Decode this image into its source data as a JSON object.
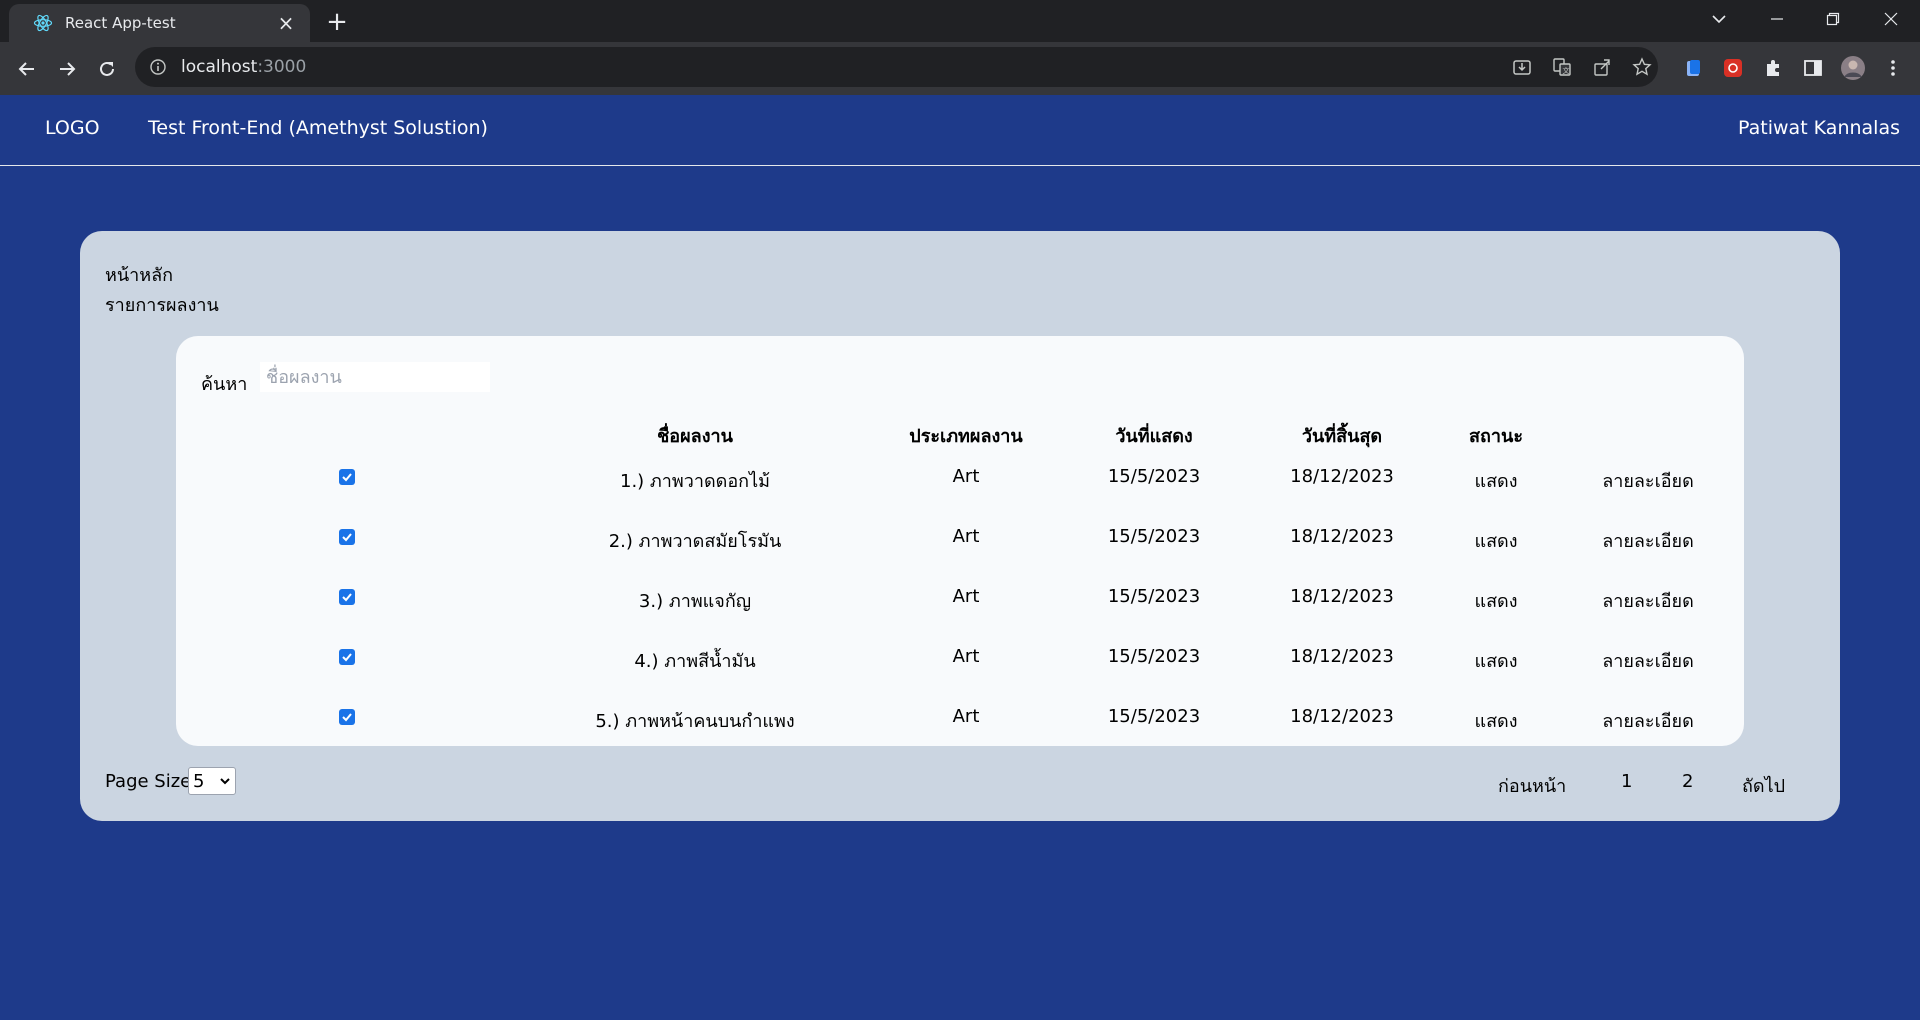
{
  "browser": {
    "tab_title": "React App-test",
    "url_host": "localhost",
    "url_port": ":3000"
  },
  "nav": {
    "logo": "LOGO",
    "title": "Test Front-End (Amethyst Solustion)",
    "user": "Patiwat Kannalas"
  },
  "breadcrumb": {
    "home": "หน้าหลัก",
    "current": "รายการผลงาน"
  },
  "search": {
    "label": "ค้นหา",
    "placeholder": "ชื่อผลงาน"
  },
  "table": {
    "headers": {
      "name": "ชื่อผลงาน",
      "type": "ประเภทผลงาน",
      "start": "วันที่แสดง",
      "end": "วันที่สิ้นสุด",
      "status": "สถานะ"
    },
    "rows": [
      {
        "checked": true,
        "name": "1.) ภาพวาดดอกไม้",
        "type": "Art",
        "start": "15/5/2023",
        "end": "18/12/2023",
        "status": "แสดง",
        "detail": "ลายละเอียด"
      },
      {
        "checked": true,
        "name": "2.) ภาพวาดสมัยโรมัน",
        "type": "Art",
        "start": "15/5/2023",
        "end": "18/12/2023",
        "status": "แสดง",
        "detail": "ลายละเอียด"
      },
      {
        "checked": true,
        "name": "3.) ภาพแจกัญ",
        "type": "Art",
        "start": "15/5/2023",
        "end": "18/12/2023",
        "status": "แสดง",
        "detail": "ลายละเอียด"
      },
      {
        "checked": true,
        "name": "4.) ภาพสีน้ำมัน",
        "type": "Art",
        "start": "15/5/2023",
        "end": "18/12/2023",
        "status": "แสดง",
        "detail": "ลายละเอียด"
      },
      {
        "checked": true,
        "name": "5.) ภาพหน้าคนบนกำแพง",
        "type": "Art",
        "start": "15/5/2023",
        "end": "18/12/2023",
        "status": "แสดง",
        "detail": "ลายละเอียด"
      }
    ]
  },
  "footer": {
    "page_size_label": "Page Size",
    "page_size_value": "5",
    "prev": "ก่อนหน้า",
    "page1": "1",
    "page2": "2",
    "next": "ถัดไป"
  }
}
